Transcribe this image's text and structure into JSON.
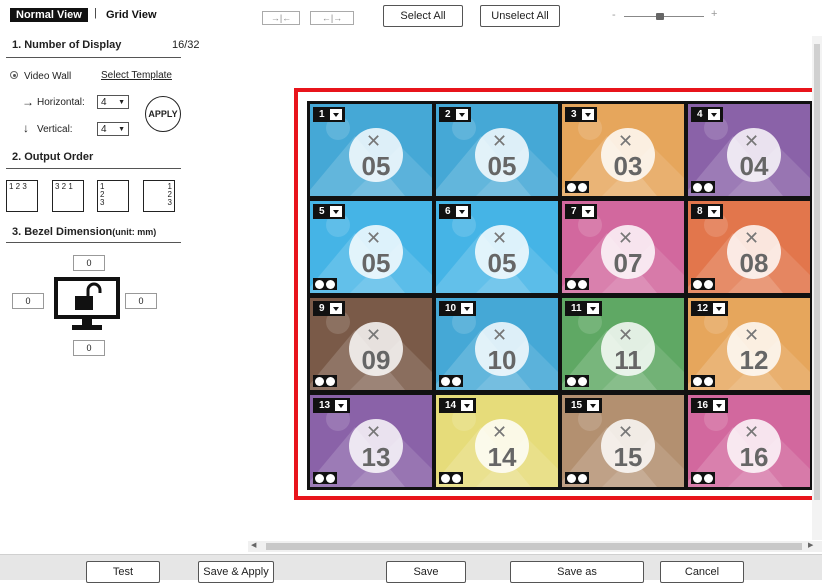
{
  "tabs": {
    "normal": "Normal View",
    "separator": "|",
    "grid": "Grid View"
  },
  "toolbar": {
    "align_icons": [
      "align-collapse-icon",
      "align-expand-icon"
    ],
    "select_all": "Select All",
    "unselect_all": "Unselect All",
    "zoom_minus": "-",
    "zoom_plus": "+",
    "zoom_level": 0.45
  },
  "panel": {
    "number_of_display": {
      "title": "1.  Number of Display",
      "count": "16/32"
    },
    "video_wall": {
      "label": "Video Wall",
      "template_link": "Select Template"
    },
    "horizontal": {
      "label": "Horizontal:",
      "value": "4"
    },
    "vertical": {
      "label": "Vertical:",
      "value": "4"
    },
    "apply": "APPLY",
    "output_order": {
      "title": "2.  Output Order",
      "options": [
        "1 2 3",
        "3 2 1",
        "1\n2\n3",
        "1\n2\n3"
      ]
    },
    "bezel": {
      "title": "3.  Bezel Dimension",
      "unit": "(unit: mm)",
      "top": "0",
      "left": "0",
      "right": "0",
      "bottom": "0"
    }
  },
  "wall": {
    "tiles": [
      {
        "index": "1",
        "source": "05",
        "color": "#45a8d6",
        "media": false
      },
      {
        "index": "2",
        "source": "05",
        "color": "#45a8d6",
        "media": false
      },
      {
        "index": "3",
        "source": "03",
        "color": "#e6a65c",
        "media": true
      },
      {
        "index": "4",
        "source": "04",
        "color": "#8a62a8",
        "media": true
      },
      {
        "index": "5",
        "source": "05",
        "color": "#45b4e6",
        "media": true
      },
      {
        "index": "6",
        "source": "05",
        "color": "#45b4e6",
        "media": false
      },
      {
        "index": "7",
        "source": "07",
        "color": "#d2689e",
        "media": true
      },
      {
        "index": "8",
        "source": "08",
        "color": "#e2764c",
        "media": true
      },
      {
        "index": "9",
        "source": "09",
        "color": "#7a5a48",
        "media": true
      },
      {
        "index": "10",
        "source": "10",
        "color": "#45a8d6",
        "media": true
      },
      {
        "index": "11",
        "source": "11",
        "color": "#5fa864",
        "media": true
      },
      {
        "index": "12",
        "source": "12",
        "color": "#e6a65c",
        "media": true
      },
      {
        "index": "13",
        "source": "13",
        "color": "#8a62a8",
        "media": true
      },
      {
        "index": "14",
        "source": "14",
        "color": "#e6dc7a",
        "media": true
      },
      {
        "index": "15",
        "source": "15",
        "color": "#b39070",
        "media": true
      },
      {
        "index": "16",
        "source": "16",
        "color": "#d2689e",
        "media": true
      }
    ]
  },
  "bottom": {
    "test": "Test",
    "save_apply": "Save & Apply",
    "save": "Save",
    "save_as": "Save as",
    "cancel": "Cancel"
  },
  "colors": {
    "frame": "#e8141b",
    "wall_bg": "#111111"
  }
}
